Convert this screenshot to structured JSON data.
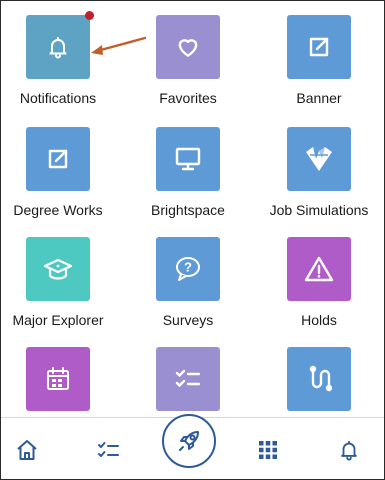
{
  "tiles": [
    {
      "label": "Notifications",
      "icon": "bell-icon",
      "color": "#5fa3c4",
      "badge": true
    },
    {
      "label": "Favorites",
      "icon": "heart-icon",
      "color": "#9a8fd0"
    },
    {
      "label": "Banner",
      "icon": "external-link-icon",
      "color": "#5e9bd6"
    },
    {
      "label": "Degree Works",
      "icon": "external-link-icon",
      "color": "#5e9bd6"
    },
    {
      "label": "Brightspace",
      "icon": "monitor-icon",
      "color": "#5e9bd6"
    },
    {
      "label": "Job Simulations",
      "icon": "vmock-logo-icon",
      "color": "#5e9bd6"
    },
    {
      "label": "Major Explorer",
      "icon": "graduation-cap-icon",
      "color": "#4ec9c2"
    },
    {
      "label": "Surveys",
      "icon": "question-bubble-icon",
      "color": "#5e9bd6"
    },
    {
      "label": "Holds",
      "icon": "warning-triangle-icon",
      "color": "#b05cc8"
    },
    {
      "label": "",
      "icon": "calendar-icon",
      "color": "#b05cc8"
    },
    {
      "label": "",
      "icon": "checklist-icon",
      "color": "#9a8fd0"
    },
    {
      "label": "",
      "icon": "route-icon",
      "color": "#5e9bd6"
    }
  ],
  "annotation": {
    "arrow_color": "#c0602a"
  },
  "bottom_nav": {
    "items": [
      "home-icon",
      "checklist-icon",
      "rocket-icon",
      "apps-grid-icon",
      "bell-icon"
    ],
    "accent": "#2f5a9a"
  }
}
